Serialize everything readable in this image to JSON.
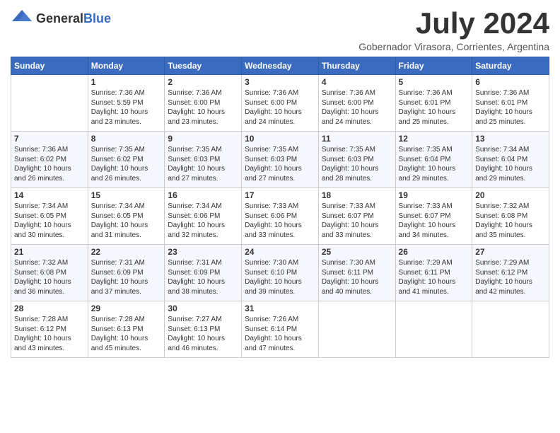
{
  "header": {
    "logo_general": "General",
    "logo_blue": "Blue",
    "month_year": "July 2024",
    "location": "Gobernador Virasora, Corrientes, Argentina"
  },
  "calendar": {
    "columns": [
      "Sunday",
      "Monday",
      "Tuesday",
      "Wednesday",
      "Thursday",
      "Friday",
      "Saturday"
    ],
    "weeks": [
      [
        {
          "day": "",
          "info": ""
        },
        {
          "day": "1",
          "info": "Sunrise: 7:36 AM\nSunset: 5:59 PM\nDaylight: 10 hours\nand 23 minutes."
        },
        {
          "day": "2",
          "info": "Sunrise: 7:36 AM\nSunset: 6:00 PM\nDaylight: 10 hours\nand 23 minutes."
        },
        {
          "day": "3",
          "info": "Sunrise: 7:36 AM\nSunset: 6:00 PM\nDaylight: 10 hours\nand 24 minutes."
        },
        {
          "day": "4",
          "info": "Sunrise: 7:36 AM\nSunset: 6:00 PM\nDaylight: 10 hours\nand 24 minutes."
        },
        {
          "day": "5",
          "info": "Sunrise: 7:36 AM\nSunset: 6:01 PM\nDaylight: 10 hours\nand 25 minutes."
        },
        {
          "day": "6",
          "info": "Sunrise: 7:36 AM\nSunset: 6:01 PM\nDaylight: 10 hours\nand 25 minutes."
        }
      ],
      [
        {
          "day": "7",
          "info": "Sunrise: 7:36 AM\nSunset: 6:02 PM\nDaylight: 10 hours\nand 26 minutes."
        },
        {
          "day": "8",
          "info": "Sunrise: 7:35 AM\nSunset: 6:02 PM\nDaylight: 10 hours\nand 26 minutes."
        },
        {
          "day": "9",
          "info": "Sunrise: 7:35 AM\nSunset: 6:03 PM\nDaylight: 10 hours\nand 27 minutes."
        },
        {
          "day": "10",
          "info": "Sunrise: 7:35 AM\nSunset: 6:03 PM\nDaylight: 10 hours\nand 27 minutes."
        },
        {
          "day": "11",
          "info": "Sunrise: 7:35 AM\nSunset: 6:03 PM\nDaylight: 10 hours\nand 28 minutes."
        },
        {
          "day": "12",
          "info": "Sunrise: 7:35 AM\nSunset: 6:04 PM\nDaylight: 10 hours\nand 29 minutes."
        },
        {
          "day": "13",
          "info": "Sunrise: 7:34 AM\nSunset: 6:04 PM\nDaylight: 10 hours\nand 29 minutes."
        }
      ],
      [
        {
          "day": "14",
          "info": "Sunrise: 7:34 AM\nSunset: 6:05 PM\nDaylight: 10 hours\nand 30 minutes."
        },
        {
          "day": "15",
          "info": "Sunrise: 7:34 AM\nSunset: 6:05 PM\nDaylight: 10 hours\nand 31 minutes."
        },
        {
          "day": "16",
          "info": "Sunrise: 7:34 AM\nSunset: 6:06 PM\nDaylight: 10 hours\nand 32 minutes."
        },
        {
          "day": "17",
          "info": "Sunrise: 7:33 AM\nSunset: 6:06 PM\nDaylight: 10 hours\nand 33 minutes."
        },
        {
          "day": "18",
          "info": "Sunrise: 7:33 AM\nSunset: 6:07 PM\nDaylight: 10 hours\nand 33 minutes."
        },
        {
          "day": "19",
          "info": "Sunrise: 7:33 AM\nSunset: 6:07 PM\nDaylight: 10 hours\nand 34 minutes."
        },
        {
          "day": "20",
          "info": "Sunrise: 7:32 AM\nSunset: 6:08 PM\nDaylight: 10 hours\nand 35 minutes."
        }
      ],
      [
        {
          "day": "21",
          "info": "Sunrise: 7:32 AM\nSunset: 6:08 PM\nDaylight: 10 hours\nand 36 minutes."
        },
        {
          "day": "22",
          "info": "Sunrise: 7:31 AM\nSunset: 6:09 PM\nDaylight: 10 hours\nand 37 minutes."
        },
        {
          "day": "23",
          "info": "Sunrise: 7:31 AM\nSunset: 6:09 PM\nDaylight: 10 hours\nand 38 minutes."
        },
        {
          "day": "24",
          "info": "Sunrise: 7:30 AM\nSunset: 6:10 PM\nDaylight: 10 hours\nand 39 minutes."
        },
        {
          "day": "25",
          "info": "Sunrise: 7:30 AM\nSunset: 6:11 PM\nDaylight: 10 hours\nand 40 minutes."
        },
        {
          "day": "26",
          "info": "Sunrise: 7:29 AM\nSunset: 6:11 PM\nDaylight: 10 hours\nand 41 minutes."
        },
        {
          "day": "27",
          "info": "Sunrise: 7:29 AM\nSunset: 6:12 PM\nDaylight: 10 hours\nand 42 minutes."
        }
      ],
      [
        {
          "day": "28",
          "info": "Sunrise: 7:28 AM\nSunset: 6:12 PM\nDaylight: 10 hours\nand 43 minutes."
        },
        {
          "day": "29",
          "info": "Sunrise: 7:28 AM\nSunset: 6:13 PM\nDaylight: 10 hours\nand 45 minutes."
        },
        {
          "day": "30",
          "info": "Sunrise: 7:27 AM\nSunset: 6:13 PM\nDaylight: 10 hours\nand 46 minutes."
        },
        {
          "day": "31",
          "info": "Sunrise: 7:26 AM\nSunset: 6:14 PM\nDaylight: 10 hours\nand 47 minutes."
        },
        {
          "day": "",
          "info": ""
        },
        {
          "day": "",
          "info": ""
        },
        {
          "day": "",
          "info": ""
        }
      ]
    ]
  }
}
